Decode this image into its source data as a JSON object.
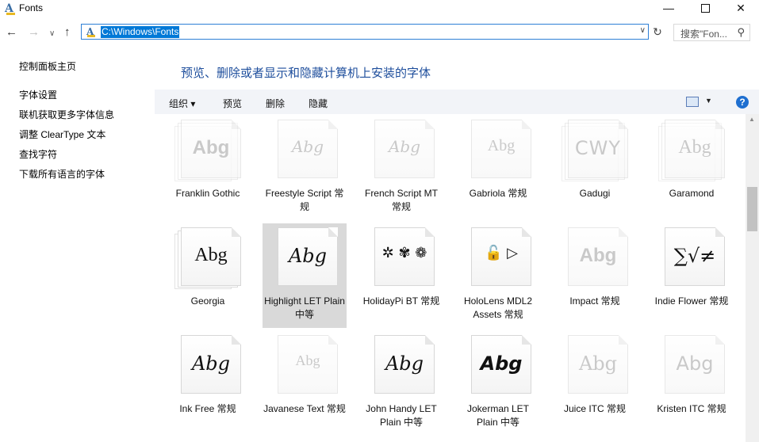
{
  "window": {
    "title": "Fonts",
    "icon": "fonts-folder-icon"
  },
  "navigation": {
    "address": "C:\\Windows\\Fonts",
    "search_placeholder": "搜索\"Fon..."
  },
  "left_pane": {
    "links": [
      "控制面板主页",
      "字体设置",
      "联机获取更多字体信息",
      "调整 ClearType 文本",
      "查找字符",
      "下载所有语言的字体"
    ]
  },
  "main": {
    "heading": "预览、删除或者显示和隐藏计算机上安装的字体"
  },
  "toolbar": {
    "organize": "组织",
    "preview": "预览",
    "delete": "删除",
    "hide": "隐藏"
  },
  "fonts": [
    {
      "label": "Franklin Gothic",
      "sample": "Abg",
      "faded": true,
      "stack": true
    },
    {
      "label": "Freestyle Script 常规",
      "sample": "Abg",
      "faded": true,
      "stack": false
    },
    {
      "label": "French Script MT 常规",
      "sample": "Abg",
      "faded": true,
      "stack": false
    },
    {
      "label": "Gabriola 常规",
      "sample": "Abg",
      "faded": true,
      "stack": false
    },
    {
      "label": "Gadugi",
      "sample": "CWY",
      "faded": true,
      "stack": true
    },
    {
      "label": "Garamond",
      "sample": "Abg",
      "faded": true,
      "stack": true
    },
    {
      "label": "Georgia",
      "sample": "Abg",
      "faded": false,
      "stack": true
    },
    {
      "label": "Highlight LET Plain 中等",
      "sample": "Abg",
      "faded": false,
      "stack": false,
      "selected": true
    },
    {
      "label": "HolidayPi BT 常规",
      "sample": "✲ ✾ ❁",
      "faded": false,
      "stack": false
    },
    {
      "label": "HoloLens MDL2 Assets 常规",
      "sample": "🔓 ▷",
      "faded": false,
      "stack": false
    },
    {
      "label": "Impact 常规",
      "sample": "Abg",
      "faded": true,
      "stack": false
    },
    {
      "label": "Indie Flower 常规",
      "sample": "∑√≠",
      "faded": false,
      "stack": false
    },
    {
      "label": "Ink Free 常规",
      "sample": "Abg",
      "faded": false,
      "stack": false
    },
    {
      "label": "Javanese Text 常规",
      "sample": "Abg",
      "faded": true,
      "stack": false
    },
    {
      "label": "John Handy LET Plain 中等",
      "sample": "Abg",
      "faded": false,
      "stack": false
    },
    {
      "label": "Jokerman LET Plain 中等",
      "sample": "Abg",
      "faded": false,
      "stack": false
    },
    {
      "label": "Juice ITC 常规",
      "sample": "Abg",
      "faded": true,
      "stack": false
    },
    {
      "label": "Kristen ITC 常规",
      "sample": "Abg",
      "faded": true,
      "stack": false
    }
  ],
  "colors": {
    "heading": "#1e4e9c",
    "selection": "#0078d7",
    "selected_tile": "#d9d9d9",
    "help": "#1f6fd0"
  }
}
